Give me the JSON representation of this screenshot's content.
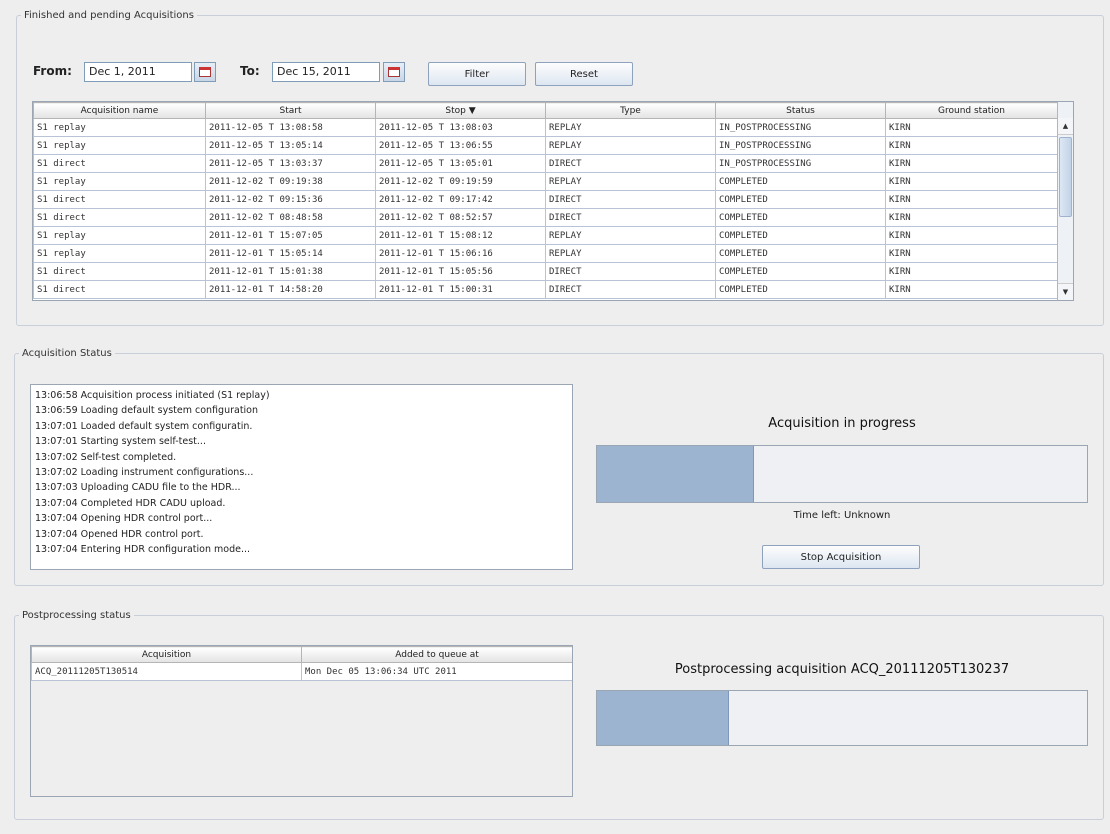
{
  "acq_panel": {
    "title": "Finished and pending Acquisitions",
    "from_label": "From:",
    "from_date": "Dec 1, 2011",
    "to_label": "To:",
    "to_date": "Dec 15, 2011",
    "filter_label": "Filter",
    "reset_label": "Reset",
    "columns": [
      "Acquisition name",
      "Start",
      "Stop ▼",
      "Type",
      "Status",
      "Ground station"
    ],
    "rows": [
      [
        "S1 replay",
        "2011-12-05 T 13:08:58",
        "2011-12-05 T 13:08:03",
        "REPLAY",
        "IN_POSTPROCESSING",
        "KIRN"
      ],
      [
        "S1 replay",
        "2011-12-05 T 13:05:14",
        "2011-12-05 T 13:06:55",
        "REPLAY",
        "IN_POSTPROCESSING",
        "KIRN"
      ],
      [
        "S1 direct",
        "2011-12-05 T 13:03:37",
        "2011-12-05 T 13:05:01",
        "DIRECT",
        "IN_POSTPROCESSING",
        "KIRN"
      ],
      [
        "S1 replay",
        "2011-12-02 T 09:19:38",
        "2011-12-02 T 09:19:59",
        "REPLAY",
        "COMPLETED",
        "KIRN"
      ],
      [
        "S1 direct",
        "2011-12-02 T 09:15:36",
        "2011-12-02 T 09:17:42",
        "DIRECT",
        "COMPLETED",
        "KIRN"
      ],
      [
        "S1 direct",
        "2011-12-02 T 08:48:58",
        "2011-12-02 T 08:52:57",
        "DIRECT",
        "COMPLETED",
        "KIRN"
      ],
      [
        "S1 replay",
        "2011-12-01 T 15:07:05",
        "2011-12-01 T 15:08:12",
        "REPLAY",
        "COMPLETED",
        "KIRN"
      ],
      [
        "S1 replay",
        "2011-12-01 T 15:05:14",
        "2011-12-01 T 15:06:16",
        "REPLAY",
        "COMPLETED",
        "KIRN"
      ],
      [
        "S1 direct",
        "2011-12-01 T 15:01:38",
        "2011-12-01 T 15:05:56",
        "DIRECT",
        "COMPLETED",
        "KIRN"
      ],
      [
        "S1 direct",
        "2011-12-01 T 14:58:20",
        "2011-12-01 T 15:00:31",
        "DIRECT",
        "COMPLETED",
        "KIRN"
      ]
    ]
  },
  "status_panel": {
    "title": "Acquisition Status",
    "log": [
      "13:06:58  Acquisition process initiated (S1 replay)",
      "13:06:59  Loading default system configuration",
      "13:07:01  Loaded default system configuratin.",
      "13:07:01  Starting system self-test...",
      "13:07:02  Self-test completed.",
      "13:07:02  Loading instrument configurations...",
      "13:07:03  Uploading CADU file to the HDR...",
      "13:07:04  Completed HDR CADU upload.",
      "13:07:04  Opening HDR control port...",
      "13:07:04  Opened HDR control port.",
      "13:07:04  Entering HDR configuration mode..."
    ],
    "heading": "Acquisition in progress",
    "progress": 0.32,
    "time_left": "Time left:  Unknown",
    "stop_label": "Stop Acquisition"
  },
  "post_panel": {
    "title": "Postprocessing status",
    "columns": [
      "Acquisition",
      "Added to queue at"
    ],
    "rows": [
      [
        "ACQ_20111205T130514",
        "Mon Dec 05 13:06:34 UTC 2011"
      ]
    ],
    "heading": "Postprocessing acquisition ACQ_20111205T130237",
    "progress": 0.27
  }
}
